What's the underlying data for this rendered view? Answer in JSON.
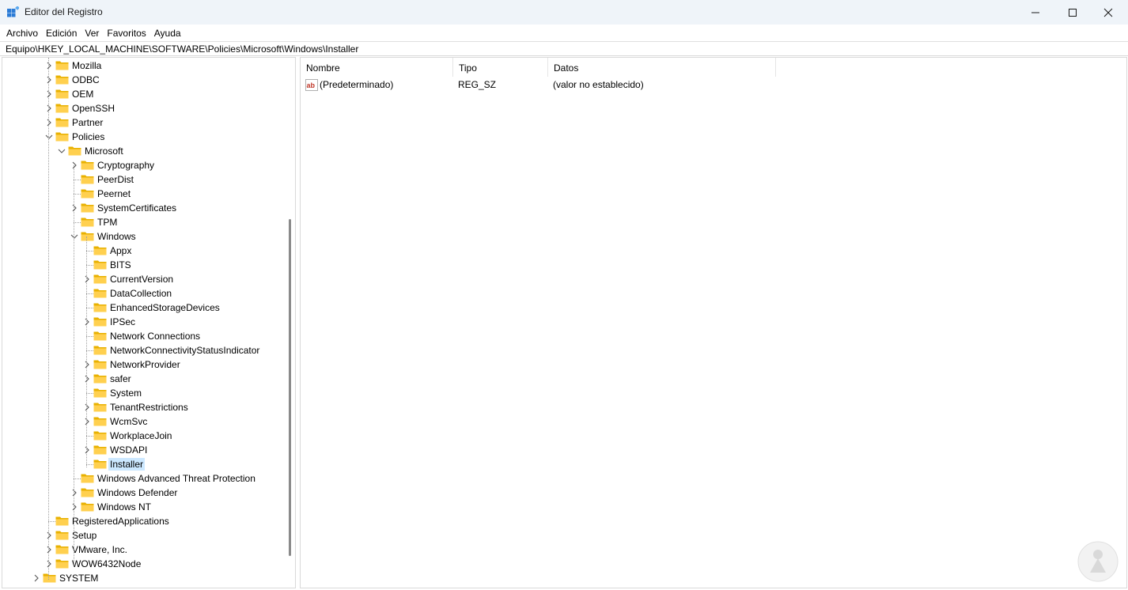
{
  "window": {
    "title": "Editor del Registro",
    "minimize_icon": "minimize-icon",
    "maximize_icon": "maximize-icon",
    "close_icon": "close-icon"
  },
  "menu": [
    "Archivo",
    "Edición",
    "Ver",
    "Favoritos",
    "Ayuda"
  ],
  "address": "Equipo\\HKEY_LOCAL_MACHINE\\SOFTWARE\\Policies\\Microsoft\\Windows\\Installer",
  "tree": [
    {
      "label": "Mozilla",
      "level": 0,
      "chevron": "right"
    },
    {
      "label": "ODBC",
      "level": 0,
      "chevron": "right"
    },
    {
      "label": "OEM",
      "level": 0,
      "chevron": "right"
    },
    {
      "label": "OpenSSH",
      "level": 0,
      "chevron": "right"
    },
    {
      "label": "Partner",
      "level": 0,
      "chevron": "right"
    },
    {
      "label": "Policies",
      "level": 0,
      "chevron": "down"
    },
    {
      "label": "Microsoft",
      "level": 1,
      "chevron": "down"
    },
    {
      "label": "Cryptography",
      "level": 2,
      "chevron": "right"
    },
    {
      "label": "PeerDist",
      "level": 2,
      "chevron": "none"
    },
    {
      "label": "Peernet",
      "level": 2,
      "chevron": "none"
    },
    {
      "label": "SystemCertificates",
      "level": 2,
      "chevron": "right"
    },
    {
      "label": "TPM",
      "level": 2,
      "chevron": "none"
    },
    {
      "label": "Windows",
      "level": 2,
      "chevron": "down"
    },
    {
      "label": "Appx",
      "level": 3,
      "chevron": "none"
    },
    {
      "label": "BITS",
      "level": 3,
      "chevron": "none"
    },
    {
      "label": "CurrentVersion",
      "level": 3,
      "chevron": "right"
    },
    {
      "label": "DataCollection",
      "level": 3,
      "chevron": "none"
    },
    {
      "label": "EnhancedStorageDevices",
      "level": 3,
      "chevron": "none"
    },
    {
      "label": "IPSec",
      "level": 3,
      "chevron": "right"
    },
    {
      "label": "Network Connections",
      "level": 3,
      "chevron": "none"
    },
    {
      "label": "NetworkConnectivityStatusIndicator",
      "level": 3,
      "chevron": "none"
    },
    {
      "label": "NetworkProvider",
      "level": 3,
      "chevron": "right"
    },
    {
      "label": "safer",
      "level": 3,
      "chevron": "right"
    },
    {
      "label": "System",
      "level": 3,
      "chevron": "none"
    },
    {
      "label": "TenantRestrictions",
      "level": 3,
      "chevron": "right"
    },
    {
      "label": "WcmSvc",
      "level": 3,
      "chevron": "right"
    },
    {
      "label": "WorkplaceJoin",
      "level": 3,
      "chevron": "none"
    },
    {
      "label": "WSDAPI",
      "level": 3,
      "chevron": "right"
    },
    {
      "label": "Installer",
      "level": 3,
      "chevron": "none",
      "selected": true
    },
    {
      "label": "Windows Advanced Threat Protection",
      "level": 2,
      "chevron": "none"
    },
    {
      "label": "Windows Defender",
      "level": 2,
      "chevron": "right"
    },
    {
      "label": "Windows NT",
      "level": 2,
      "chevron": "right"
    },
    {
      "label": "RegisteredApplications",
      "level": 0,
      "chevron": "none"
    },
    {
      "label": "Setup",
      "level": 0,
      "chevron": "right"
    },
    {
      "label": "VMware, Inc.",
      "level": 0,
      "chevron": "right"
    },
    {
      "label": "WOW6432Node",
      "level": 0,
      "chevron": "right"
    },
    {
      "label": "SYSTEM",
      "level": -1,
      "chevron": "right"
    }
  ],
  "list": {
    "columns": [
      "Nombre",
      "Tipo",
      "Datos"
    ],
    "rows": [
      {
        "name": "(Predeterminado)",
        "type": "REG_SZ",
        "data": "(valor no establecido)",
        "icon": "string-value-icon"
      }
    ]
  },
  "colors": {
    "titlebar": "#eff4f9",
    "selection": "#cce8ff",
    "folder": "#ffd04f"
  }
}
